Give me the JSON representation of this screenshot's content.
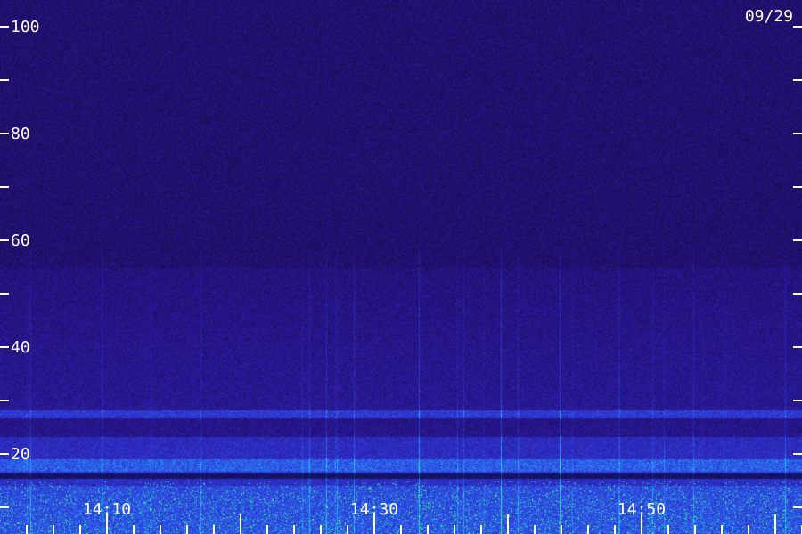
{
  "date_label": "09/29",
  "colors": {
    "background": "#1c0b55",
    "text": "#ffffff"
  },
  "chart_data": {
    "type": "heatmap",
    "title": "",
    "xlabel": "",
    "ylabel": "",
    "y_ticks": [
      "100",
      "80",
      "60",
      "40",
      "20"
    ],
    "y_range": [
      0,
      100
    ],
    "x_ticks": [
      "14:10",
      "14:30",
      "14:50"
    ],
    "x_range_minutes_past_1400": [
      2,
      62
    ],
    "colormap": [
      "#1c0b55",
      "#2a1ba0",
      "#3040e0",
      "#20c0ff",
      "#40ff80"
    ]
  }
}
